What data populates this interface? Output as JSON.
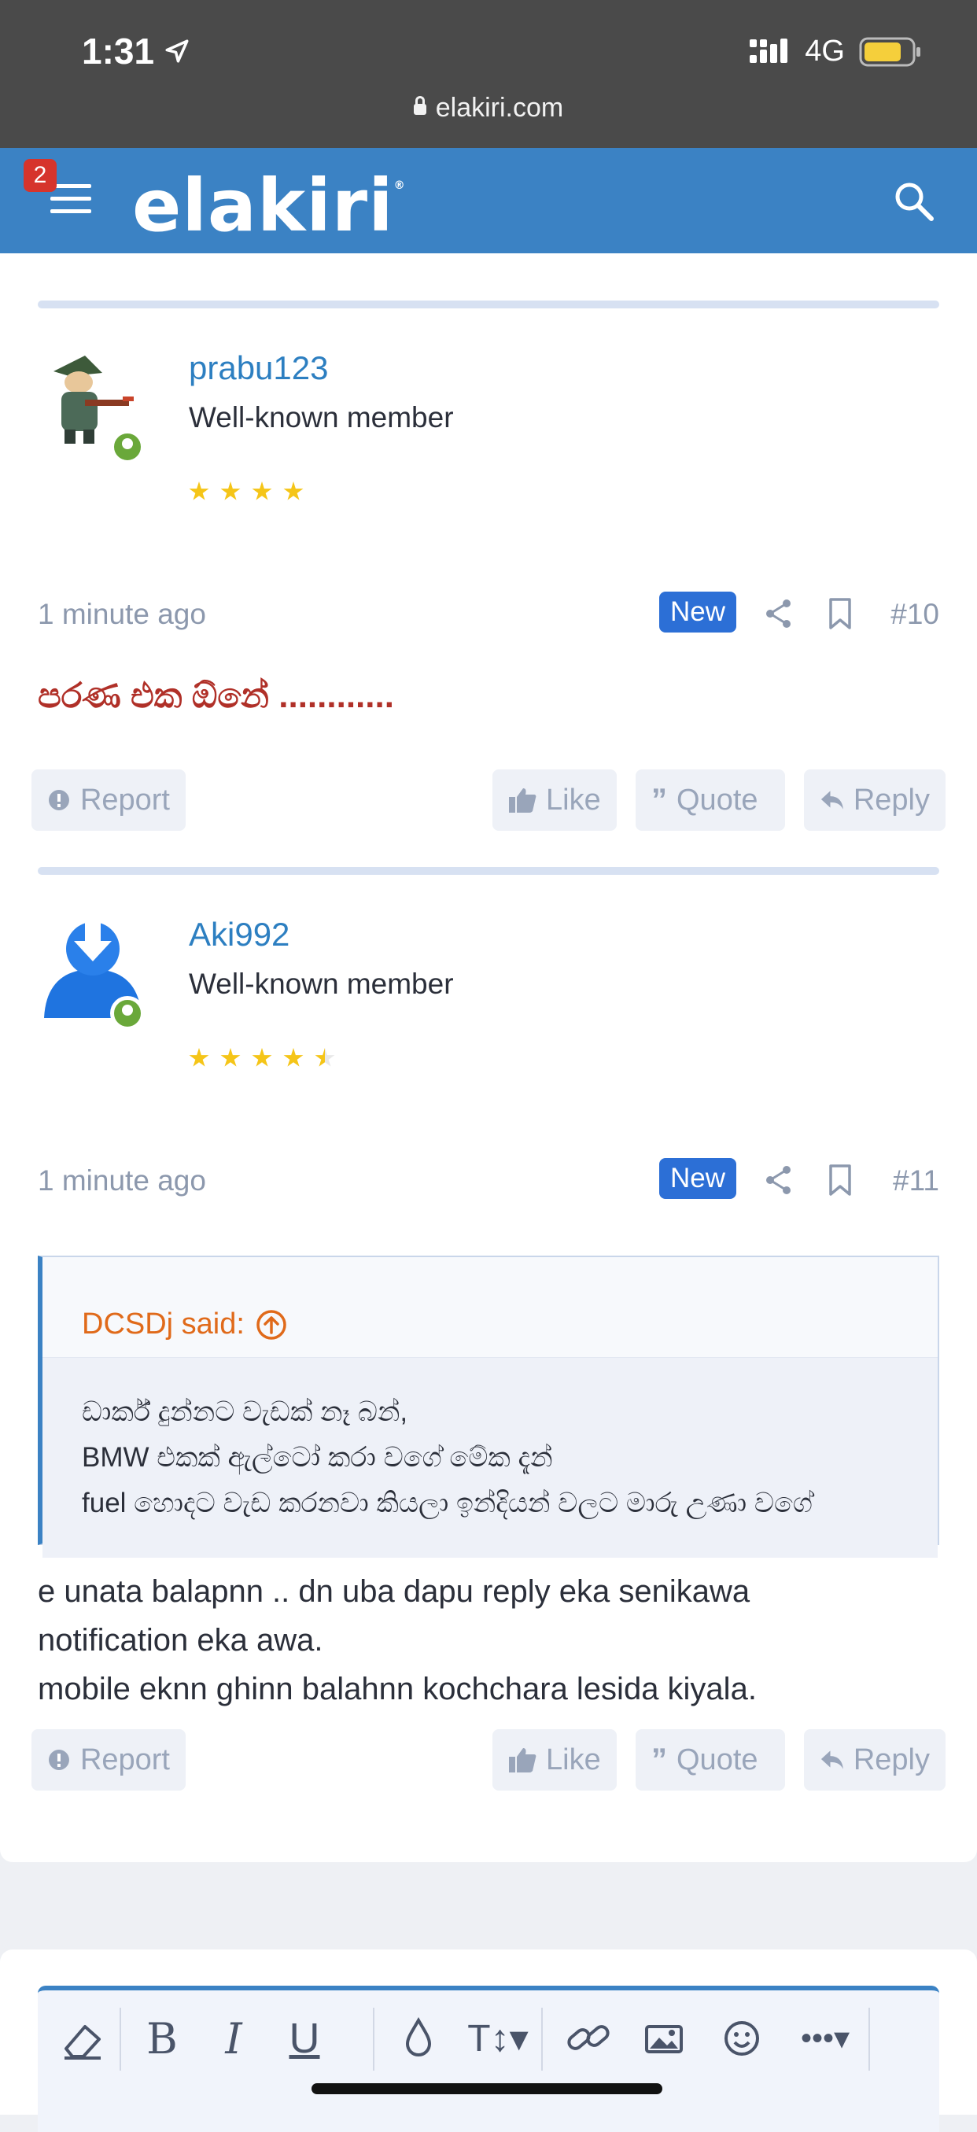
{
  "status_bar": {
    "time": "1:31",
    "network": "4G",
    "url": "elakiri.com"
  },
  "header": {
    "logo": "elakiri",
    "notification_count": "2"
  },
  "posts": [
    {
      "username": "prabu123",
      "user_title": "Well-known member",
      "rating": 4,
      "time": "1 minute ago",
      "new_label": "New",
      "number": "#10",
      "body": "පරණ එක ඕනේ ............",
      "actions": {
        "report": "Report",
        "like": "Like",
        "quote": "Quote",
        "reply": "Reply"
      }
    },
    {
      "username": "Aki992",
      "user_title": "Well-known member",
      "rating": 4.5,
      "time": "1 minute ago",
      "new_label": "New",
      "number": "#11",
      "quote": {
        "author_said": "DCSDj said:",
        "lines": [
          "ඩාර්ක් දුන්නට වැඩක් නෑ බන්,",
          "BMW එකක් ඇල්ටෝ කරා වගේ මේක දැන්",
          "fuel හොදට වැඩ කරනවා කියලා ඉන්දියන් වලට මාරු උණා වගේ"
        ]
      },
      "body_lines": [
        "e unata balapnn .. dn uba dapu reply eka senikawa",
        "notification eka awa.",
        "mobile eknn ghinn balahnn kochchara lesida kiyala."
      ],
      "actions": {
        "report": "Report",
        "like": "Like",
        "quote": "Quote",
        "reply": "Reply"
      }
    }
  ],
  "editor": {
    "toolbar": [
      "clear-format",
      "bold",
      "italic",
      "underline",
      "color",
      "text-size",
      "link",
      "image",
      "emoji",
      "more"
    ]
  },
  "colors": {
    "header_bg": "#3b82c4",
    "status_bg": "#4a4a4a",
    "username": "#2d7fc1",
    "new_badge": "#2c6fd6",
    "quote_author": "#e06a1a",
    "red_text": "#b03028"
  }
}
